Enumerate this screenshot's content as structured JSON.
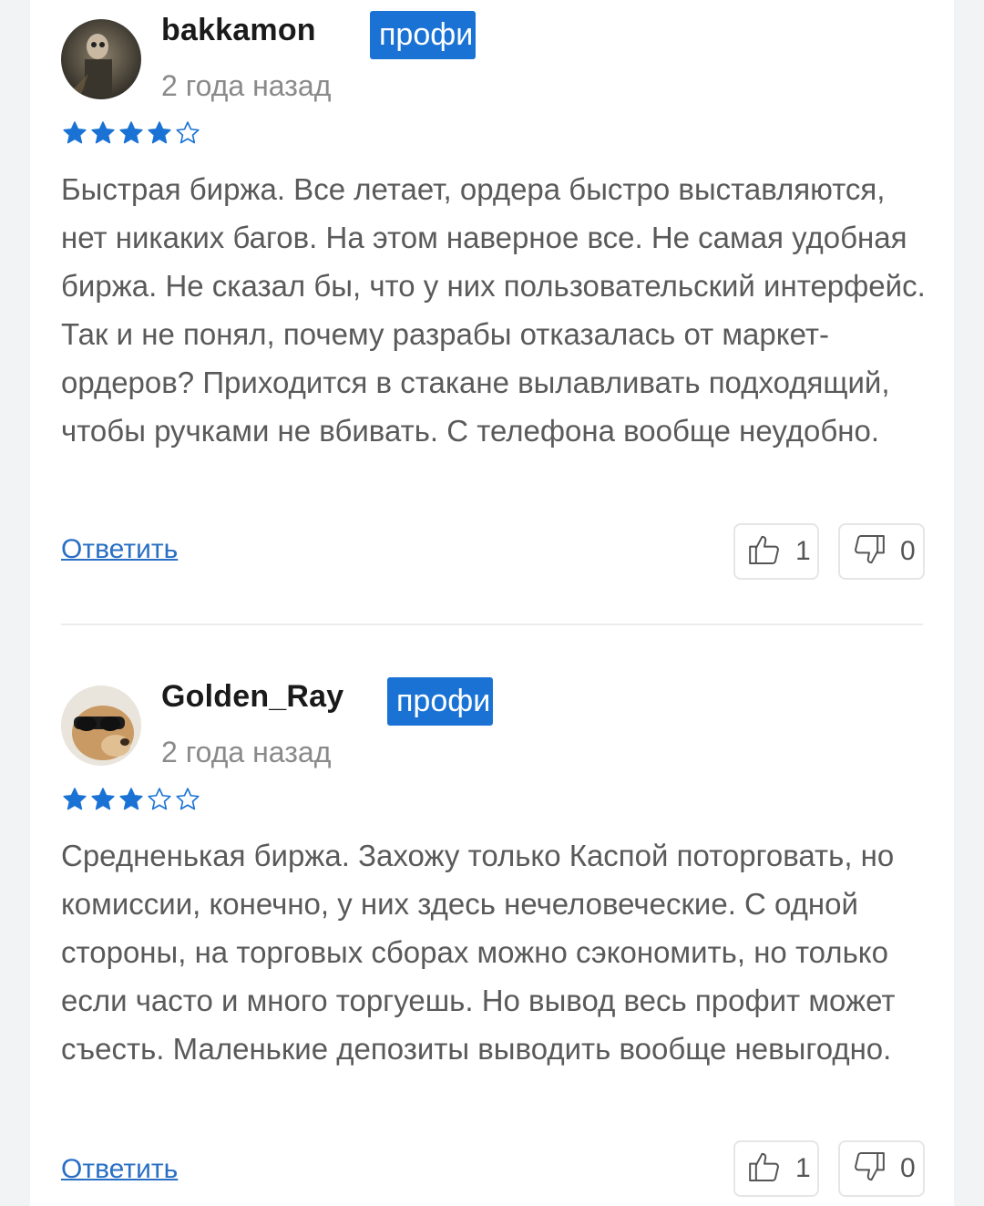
{
  "reviews": [
    {
      "username": "bakkamon",
      "badge": "профи",
      "time": "2 года назад",
      "rating": 4,
      "rating_max": 5,
      "text": "Быстрая биржа. Все летает, ордера быстро выставляются, нет никаких багов. На этом наверное все. Не самая удобная биржа. Не сказал бы, что у них пользовательский интерфейс. Так и не понял, почему разрабы отказалась от маркет-ордеров? Приходится в стакане вылавливать подходящий, чтобы ручками не вбивать. С телефона вообще неудобно.",
      "reply_label": "Ответить",
      "likes": "1",
      "dislikes": "0"
    },
    {
      "username": "Golden_Ray",
      "badge": "профи",
      "time": "2 года назад",
      "rating": 3,
      "rating_max": 5,
      "text": "Средненькая биржа. Захожу только Каспой поторговать, но комиссии, конечно, у них здесь нечеловеческие. С одной стороны, на торговых сборах можно сэкономить, но только если часто и много торгуешь. Но вывод весь профит может съесть. Маленькие депозиты выводить вообще невыгодно.",
      "reply_label": "Ответить",
      "likes": "1",
      "dislikes": "0"
    }
  ],
  "colors": {
    "accent": "#1a73d4",
    "star": "#1a73d4",
    "link": "#2a6fc4",
    "muted_text": "#8a8a8a"
  },
  "icons": {
    "like": "thumbs-up-icon",
    "dislike": "thumbs-down-icon",
    "star_filled": "star-filled-icon",
    "star_empty": "star-outline-icon"
  }
}
